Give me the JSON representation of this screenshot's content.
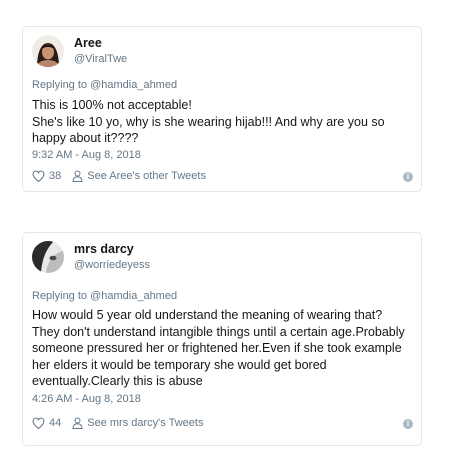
{
  "tweets": [
    {
      "name": "Aree",
      "handle": "@ViralTwe",
      "replying_to": "Replying to @hamdia_ahmed",
      "text_lines": [
        "This is 100% not acceptable!",
        "She's like 10 yo, why is she wearing hijab!!! And why are you so",
        "happy about it????"
      ],
      "timestamp": "9:32 AM - Aug 8, 2018",
      "like_count": "38",
      "other_tweets": "See Aree's other Tweets",
      "like_icon": "heart-icon",
      "profile_icon": "person-icon",
      "info_icon": "info-icon"
    },
    {
      "name": "mrs darcy",
      "handle": "@worriedeyess",
      "replying_to": "Replying to @hamdia_ahmed",
      "text_lines": [
        "How would 5 year old understand the meaning of wearing that?",
        "They don't understand intangible things until a certain age.Probably",
        "someone pressured her or frightened her.Even if she took example",
        "her elders it would be temporary she would get bored",
        "eventually.Clearly this is abuse"
      ],
      "timestamp": "4:26 AM - Aug 8, 2018",
      "like_count": "44",
      "other_tweets": "See mrs darcy's Tweets",
      "like_icon": "heart-icon",
      "profile_icon": "person-icon",
      "info_icon": "info-icon"
    }
  ],
  "colors": {
    "text": "#14171a",
    "secondary": "#657786",
    "border": "#e1e8ed",
    "info": "#aab8c2"
  }
}
